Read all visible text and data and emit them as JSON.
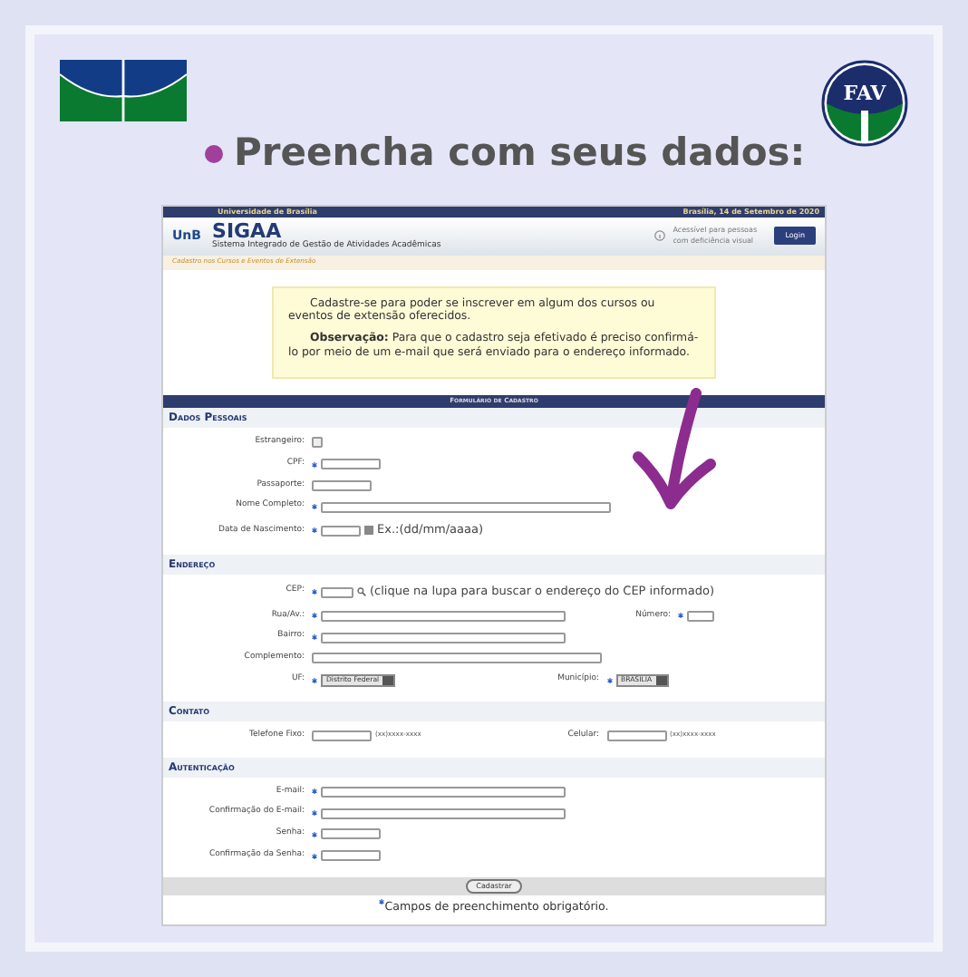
{
  "slide": {
    "title": "Preencha com seus dados:",
    "logo_right_text": "FAV"
  },
  "screenshot": {
    "header": {
      "university": "Universidade de Brasília",
      "date": "Brasília, 14 de Setembro de 2020",
      "logo_text": "UnB",
      "system_name": "SIGAA",
      "system_subtitle": "Sistema Integrado de Gestão de Atividades Acadêmicas",
      "accessibility_text": "Acessível para pessoas com deficiência visual",
      "login_button": "Login"
    },
    "breadcrumb": "Cadastro nos Cursos e Eventos de Extensão",
    "notice": [
      {
        "text": "Cadastre-se para poder se inscrever em algum dos cursos ou eventos de extensão oferecidos."
      },
      {
        "text": "**Observação:** Para que o cadastro seja efetivado é preciso confirmá-lo por meio de um e-mail que será enviado para o endereço informado."
      }
    ],
    "form": {
      "title": "Formulário de Cadastro",
      "sections": [
        {
          "title": "Dados Pessoais",
          "rows": [
            [
              {
                "label": "Estrangeiro:",
                "required": false,
                "kind": "checkbox",
                "checked": false
              }
            ],
            [
              {
                "label": "CPF:",
                "required": true,
                "kind": "short"
              }
            ],
            [
              {
                "label": "Passaporte:",
                "required": false,
                "kind": "short"
              }
            ],
            [
              {
                "label": "Nome Completo:",
                "required": true,
                "kind": "long"
              }
            ],
            [
              {
                "label": "Data de Nascimento:",
                "required": true,
                "kind": "date",
                "hint": "Ex.:(dd/mm/aaaa)"
              }
            ]
          ]
        },
        {
          "title": "Endereço",
          "rows": [
            [
              {
                "label": "CEP:",
                "required": true,
                "kind": "cep",
                "hint": "(clique na lupa para buscar o endereço do CEP informado)"
              }
            ],
            [
              {
                "label": "Rua/Av.:",
                "required": true,
                "kind": "medium"
              },
              {
                "label": "Número:",
                "required": true,
                "kind": "tiny"
              }
            ],
            [
              {
                "label": "Bairro:",
                "required": true,
                "kind": "medium"
              }
            ],
            [
              {
                "label": "Complemento:",
                "required": false,
                "kind": "long"
              }
            ],
            [
              {
                "label": "UF:",
                "required": true,
                "kind": "select",
                "value": "Distrito Federal"
              },
              {
                "label": "Município:",
                "required": true,
                "kind": "select",
                "value": "BRASILIA"
              }
            ]
          ]
        },
        {
          "title": "Contato",
          "rows": [
            [
              {
                "label": "Telefone Fixo:",
                "required": false,
                "kind": "short",
                "hint": "(xx)xxxx-xxxx"
              },
              {
                "label": "Celular:",
                "required": false,
                "kind": "short",
                "hint": "(xx)xxxx-xxxx"
              }
            ]
          ]
        },
        {
          "title": "Autenticação",
          "rows": [
            [
              {
                "label": "E-mail:",
                "required": true,
                "kind": "medium"
              }
            ],
            [
              {
                "label": "Confirmação do E-mail:",
                "required": true,
                "kind": "medium"
              }
            ],
            [
              {
                "label": "Senha:",
                "required": true,
                "kind": "short"
              }
            ],
            [
              {
                "label": "Confirmação da Senha:",
                "required": true,
                "kind": "short"
              }
            ]
          ]
        }
      ],
      "submit": "Cadastrar",
      "footnote": "Campos de preenchimento obrigatório."
    }
  }
}
